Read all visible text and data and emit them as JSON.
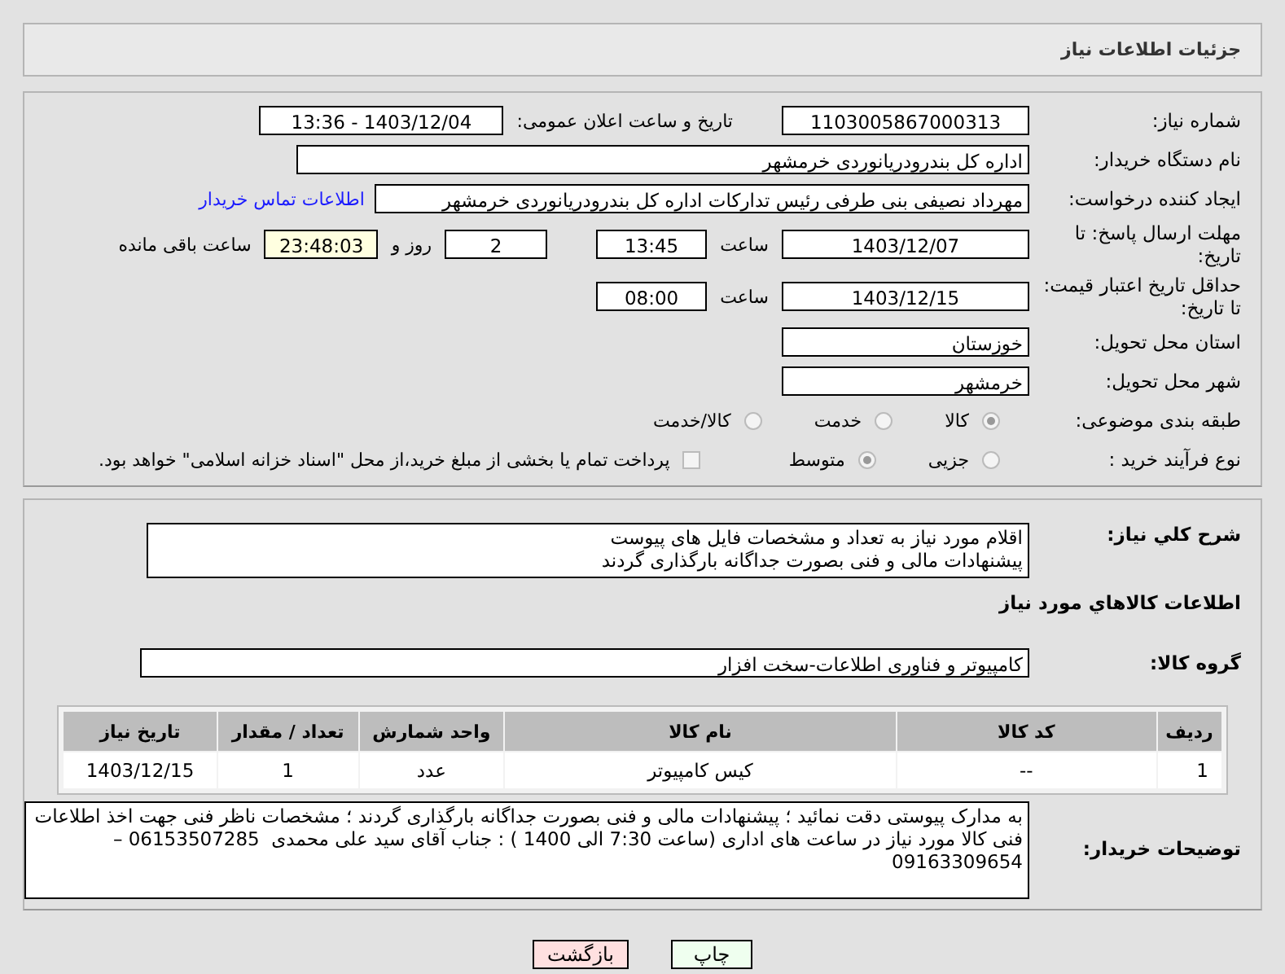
{
  "header": {
    "title": "جزئیات اطلاعات نیاز"
  },
  "need_number": {
    "label": "شماره نیاز:",
    "value": "1103005867000313"
  },
  "announce": {
    "label": "تاریخ و ساعت اعلان عمومی:",
    "value": "1403/12/04 - 13:36"
  },
  "buyer_org": {
    "label": "نام دستگاه خریدار:",
    "value": "اداره کل بندرودریانوردی خرمشهر"
  },
  "requester": {
    "label": "ایجاد کننده درخواست:",
    "value": "مهرداد  نصیفی بنی طرفی رئیس تدارکات اداره کل بندرودریانوردی خرمشهر",
    "link": "اطلاعات تماس خریدار"
  },
  "reply_deadline": {
    "label": "مهلت ارسال پاسخ: تا تاریخ:",
    "date": "1403/12/07",
    "time_label": "ساعت",
    "time": "13:45",
    "days": "2",
    "days_label": "روز و",
    "remaining": "23:48:03",
    "remaining_label": "ساعت باقی مانده"
  },
  "price_validity": {
    "label": "حداقل تاریخ اعتبار قیمت: تا تاریخ:",
    "date": "1403/12/15",
    "time_label": "ساعت",
    "time": "08:00"
  },
  "province": {
    "label": "استان محل تحویل:",
    "value": "خوزستان"
  },
  "city": {
    "label": "شهر محل تحویل:",
    "value": "خرمشهر"
  },
  "category": {
    "label": "طبقه بندی موضوعی:",
    "options": [
      {
        "label": "کالا",
        "selected": true
      },
      {
        "label": "خدمت",
        "selected": false
      },
      {
        "label": "کالا/خدمت",
        "selected": false
      }
    ]
  },
  "purchase_type": {
    "label": "نوع فرآیند خرید :",
    "options": [
      {
        "label": "جزیی",
        "selected": false
      },
      {
        "label": "متوسط",
        "selected": true
      }
    ],
    "checkbox": {
      "label": "پرداخت تمام یا بخشی از مبلغ خرید،از محل \"اسناد خزانه اسلامی\" خواهد بود.",
      "checked": false
    }
  },
  "description": {
    "label": "شرح کلي نياز:",
    "value": "اقلام مورد نیاز به تعداد و مشخصات فایل های پیوست\nپیشنهادات مالی و فنی بصورت جداگانه بارگذاری گردند"
  },
  "goods_title": "اطلاعات کالاهاي مورد نياز",
  "goods_group": {
    "label": "گروه کالا:",
    "value": "کامپیوتر و فناوری اطلاعات-سخت افزار"
  },
  "table": {
    "columns": [
      "ردیف",
      "کد کالا",
      "نام کالا",
      "واحد شمارش",
      "تعداد / مقدار",
      "تاریخ نیاز"
    ],
    "rows": [
      [
        "1",
        "--",
        "کیس کامپیوتر",
        "عدد",
        "1",
        "1403/12/15"
      ]
    ]
  },
  "buyer_notes": {
    "label": "توضیحات خریدار:",
    "value": "به مدارک پیوستی دقت نمائید ؛ پیشنهادات مالی و فنی بصورت جداگانه بارگذاری گردند ؛ مشخصات ناظر فنی جهت اخذ اطلاعات فنی کالا مورد نیاز در ساعت های اداری (ساعت 7:30 الی 1400 ) : جناب آقای سید علی محمدی  06153507285 – 09163309654"
  },
  "buttons": [
    {
      "label": "چاپ",
      "kind": "print"
    },
    {
      "label": "بازگشت",
      "kind": "back"
    }
  ]
}
